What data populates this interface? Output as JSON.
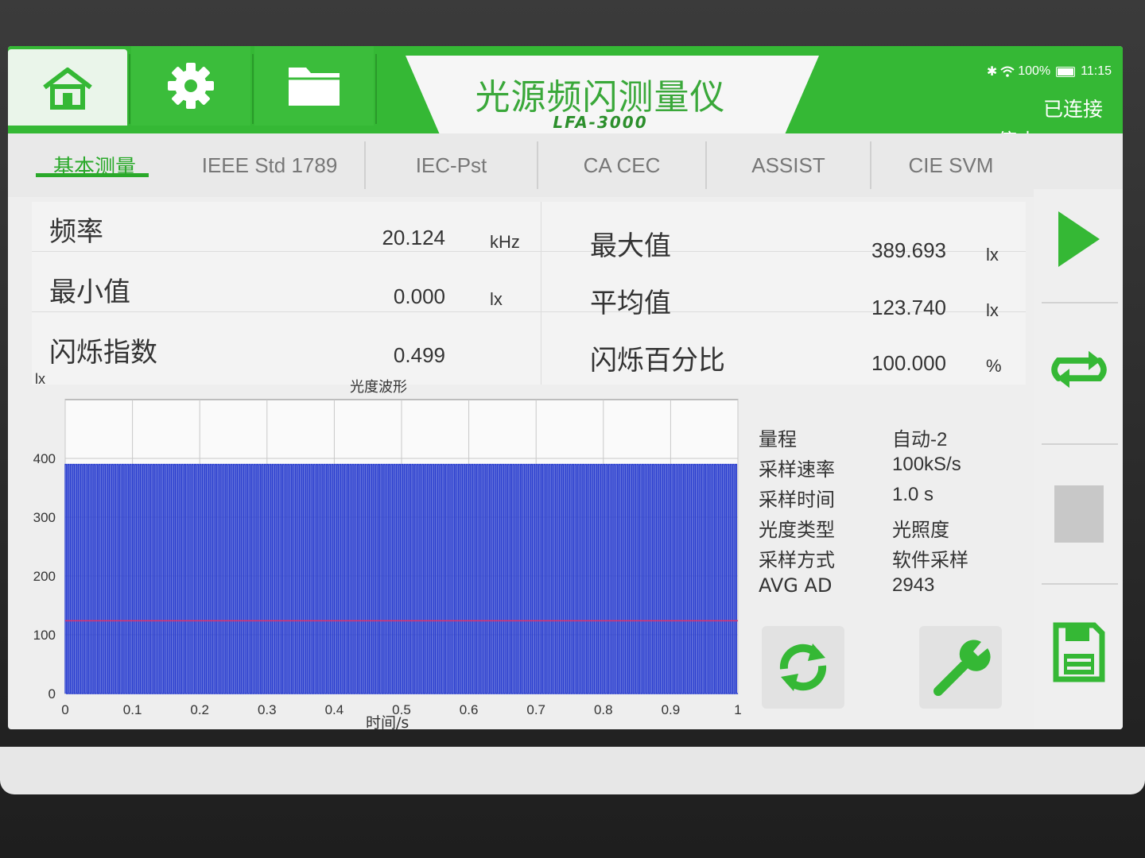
{
  "app": {
    "title": "光源频闪测量仪",
    "model": "LFA-3000"
  },
  "status_bar": {
    "battery": "100%",
    "time": "11:15"
  },
  "connection": {
    "status": "已连接",
    "stop_label": "停止"
  },
  "nav": [
    {
      "icon": "home-icon"
    },
    {
      "icon": "gear-icon"
    },
    {
      "icon": "folder-icon"
    }
  ],
  "tabs": [
    "基本测量",
    "IEEE Std 1789",
    "IEC-Pst",
    "CA CEC",
    "ASSIST",
    "CIE SVM"
  ],
  "measurements": {
    "frequency": {
      "label": "频率",
      "value": "20.124",
      "unit": "kHz"
    },
    "min": {
      "label": "最小值",
      "value": "0.000",
      "unit": "lx"
    },
    "flicker_index": {
      "label": "闪烁指数",
      "value": "0.499"
    },
    "max": {
      "label": "最大值",
      "value": "389.693",
      "unit": "lx"
    },
    "avg": {
      "label": "平均值",
      "value": "123.740",
      "unit": "lx"
    },
    "flicker_percent": {
      "label": "闪烁百分比",
      "value": "100.000",
      "unit": "%"
    }
  },
  "info": [
    {
      "key": "量程",
      "value": "自动-2"
    },
    {
      "key": "采样速率",
      "value": "100kS/s"
    },
    {
      "key": "采样时间",
      "value": "1.0 s"
    },
    {
      "key": "光度类型",
      "value": "光照度"
    },
    {
      "key": "采样方式",
      "value": "软件采样"
    },
    {
      "key": "AVG AD",
      "value": "2943"
    }
  ],
  "sidebar": [
    "play-icon",
    "loop-icon",
    "stop-square-icon",
    "save-icon"
  ],
  "actions": [
    "refresh-icon",
    "wrench-icon"
  ],
  "colors": {
    "brand_green": "#35b835",
    "waveform": "#2b3fcf",
    "average_line": "#e0306a"
  },
  "chart_data": {
    "type": "line",
    "title": "光度波形",
    "xlabel": "时间/s",
    "ylabel": "lx",
    "xlim": [
      0,
      1
    ],
    "ylim": [
      0,
      500
    ],
    "x_ticks": [
      "0",
      "0.1",
      "0.2",
      "0.3",
      "0.4",
      "0.5",
      "0.6",
      "0.7",
      "0.8",
      "0.9",
      "1"
    ],
    "y_ticks": [
      "0",
      "100",
      "200",
      "300",
      "400"
    ],
    "series": [
      {
        "type": "square-wave",
        "min": 0,
        "max": 389.693
      },
      {
        "type": "hline",
        "value": 123.74
      }
    ],
    "grid": true
  }
}
